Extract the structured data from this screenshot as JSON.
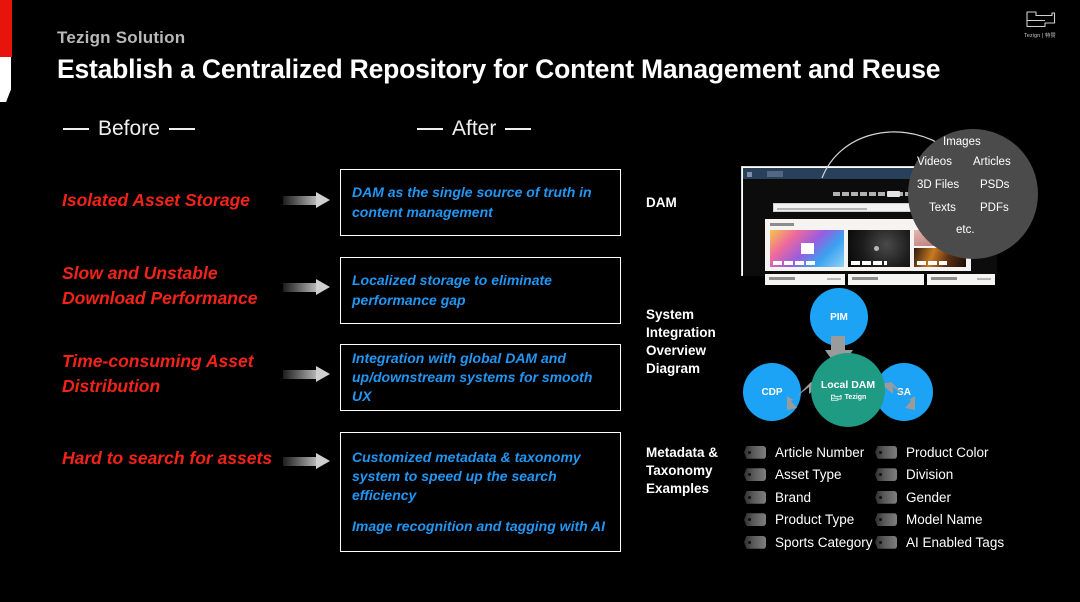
{
  "brand": {
    "eyebrow": "Tezign Solution",
    "logo_text": "Tezign | 特赞",
    "accent_red": "#e8140c",
    "accent_blue": "#2196f3",
    "accent_teal": "#1f9a83",
    "node_blue": "#1ca3f5"
  },
  "header": {
    "title": "Establish a Centralized Repository for Content Management and Reuse"
  },
  "columns": {
    "before_label": "Before",
    "after_label": "After"
  },
  "before_items": [
    {
      "text": "Isolated Asset Storage"
    },
    {
      "text": "Slow and Unstable Download Performance"
    },
    {
      "text": "Time-consuming Asset Distribution"
    },
    {
      "text": "Hard to search for assets"
    }
  ],
  "after_items": [
    {
      "lines": [
        "DAM as the single source of truth in content management"
      ]
    },
    {
      "lines": [
        "Localized storage to eliminate performance gap"
      ]
    },
    {
      "lines": [
        "Integration with global DAM and up/downstream systems for smooth UX"
      ]
    },
    {
      "lines": [
        "Customized metadata & taxonomy system to speed up the search efficiency",
        "Image recognition and tagging with AI"
      ]
    }
  ],
  "right": {
    "dam_label": "DAM",
    "diagram_label": "System Integration Overview Diagram",
    "metadata_label": "Metadata & Taxonomy Examples"
  },
  "bubble": {
    "items": [
      "Images",
      "Videos",
      "Articles",
      "3D Files",
      "PSDs",
      "Texts",
      "PDFs",
      "etc."
    ]
  },
  "diagram": {
    "nodes": [
      {
        "id": "pim",
        "label": "PIM",
        "color": "#1ca3f5"
      },
      {
        "id": "cdp",
        "label": "CDP",
        "color": "#1ca3f5"
      },
      {
        "id": "sa",
        "label": "SA",
        "color": "#1ca3f5"
      },
      {
        "id": "dam",
        "label": "Local DAM",
        "brand": "Tezign",
        "color": "#1f9a83"
      }
    ]
  },
  "metadata_tags": {
    "column1": [
      "Article Number",
      "Asset Type",
      "Brand",
      "Product Type",
      "Sports Category"
    ],
    "column2": [
      "Product Color",
      "Division",
      "Gender",
      "Model Name",
      "AI Enabled Tags"
    ]
  }
}
